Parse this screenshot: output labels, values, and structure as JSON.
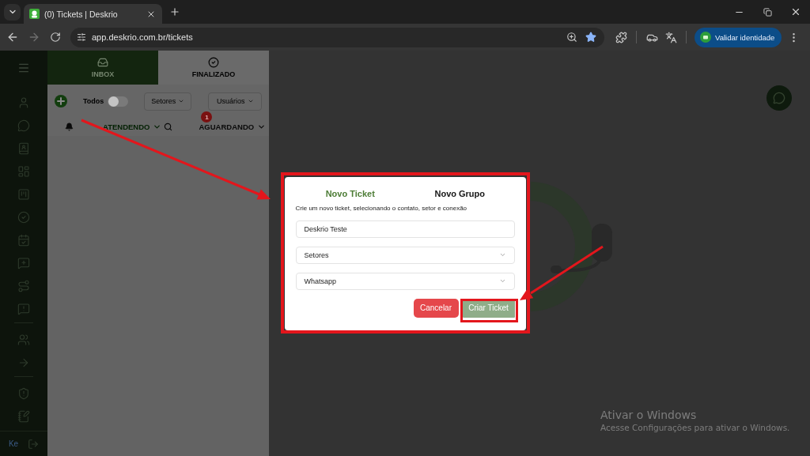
{
  "browser": {
    "tab_title": "(0) Tickets | Deskrio",
    "url": "app.deskrio.com.br/tickets",
    "identity_button": "Validar identidade"
  },
  "sidebar": {
    "user_initials": "Ke"
  },
  "ticket_tabs": [
    {
      "label": "INBOX",
      "selected": true
    },
    {
      "label": "FINALIZADO",
      "selected": false
    }
  ],
  "filters": {
    "toggle_label": "Todos",
    "toggle_on": false,
    "dropdowns": [
      "Setores",
      "Usuários"
    ]
  },
  "queues": [
    {
      "label": "ATENDENDO",
      "selected": true
    },
    {
      "label": "AGUARDANDO",
      "selected": false,
      "badge": "1"
    }
  ],
  "dialog": {
    "tabs": [
      {
        "label": "Novo Ticket",
        "selected": true
      },
      {
        "label": "Novo Grupo",
        "selected": false
      }
    ],
    "description": "Crie um novo ticket, selecionando o contato, setor e conexão",
    "fields": [
      {
        "kind": "text",
        "value": "Deskrio Teste"
      },
      {
        "kind": "select",
        "value": "Setores"
      },
      {
        "kind": "select",
        "value": "Whatsapp"
      }
    ],
    "buttons": [
      {
        "label": "Cancelar",
        "kind": "cancel"
      },
      {
        "label": "Criar Ticket",
        "kind": "confirm"
      }
    ]
  },
  "windows_notice": {
    "title": "Ativar o Windows",
    "text": "Acesse Configurações para ativar o Windows."
  }
}
